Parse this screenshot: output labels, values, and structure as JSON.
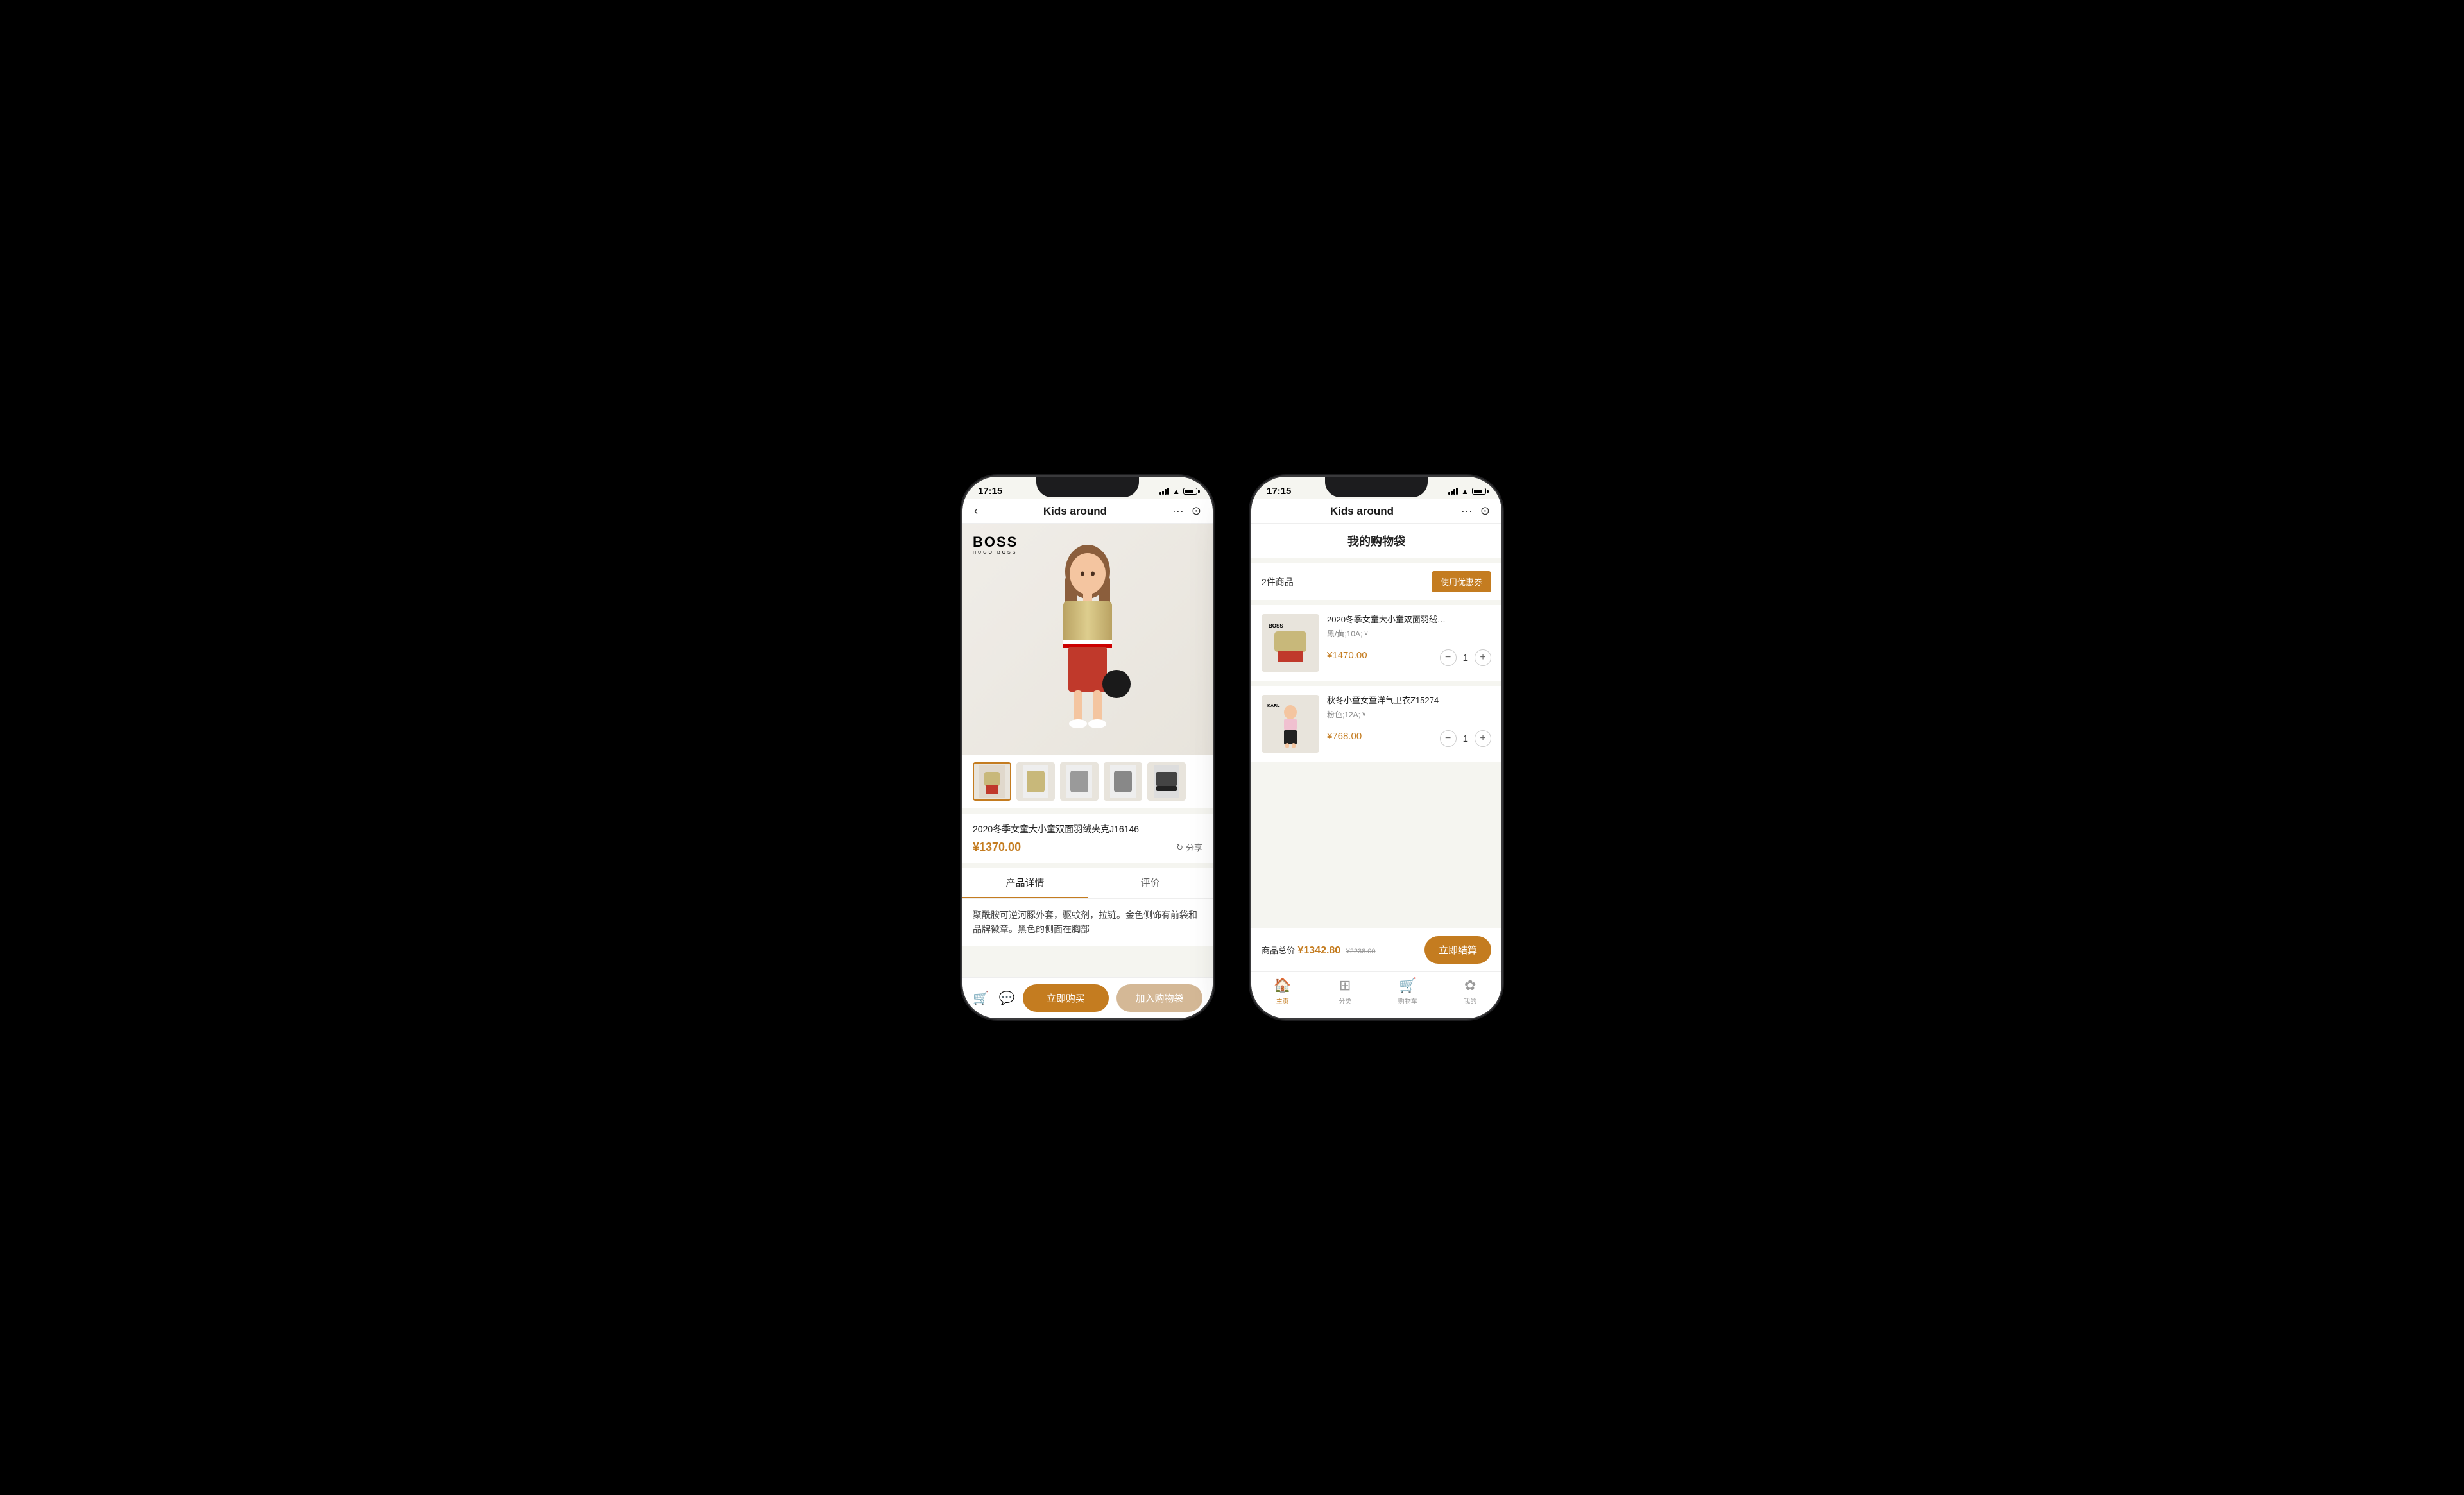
{
  "app": {
    "title": "Kids around",
    "status_time": "17:15"
  },
  "phone1": {
    "nav": {
      "back_label": "‹",
      "title": "Kids around",
      "more_label": "···",
      "scan_label": "⊙"
    },
    "product": {
      "brand": "BOSS",
      "brand_sub": "HUGO BOSS",
      "name": "2020冬季女童大小童双面羽绒夹克J16146",
      "price": "¥1370.00",
      "share_label": "分享",
      "tabs": [
        {
          "label": "产品详情",
          "active": true
        },
        {
          "label": "评价",
          "active": false
        }
      ],
      "description": "聚酰胺可逆河豚外套，驱蚊剂，拉链。金色侧饰有前袋和品牌徽章。黑色的侧面在胸部",
      "btn_buy": "立即购买",
      "btn_cart": "加入购物袋"
    }
  },
  "phone2": {
    "nav": {
      "title": "Kids around",
      "more_label": "···",
      "scan_label": "⊙"
    },
    "cart": {
      "page_title": "我的购物袋",
      "count_label": "2件商品",
      "coupon_label": "使用优惠券",
      "items": [
        {
          "id": 1,
          "name": "2020冬季女童大小童双面羽绒…",
          "variant": "黑/黄;10A;",
          "price": "¥1470.00",
          "qty": 1
        },
        {
          "id": 2,
          "name": "秋冬小童女童洋气卫衣Z15274",
          "variant": "粉色;12A;",
          "price": "¥768.00",
          "qty": 1
        }
      ],
      "total_label": "商品总价",
      "total_price": "¥1342.80",
      "original_price": "¥2238.00",
      "checkout_label": "立即结算"
    },
    "bottom_nav": [
      {
        "label": "主页",
        "icon": "🏠",
        "active": true
      },
      {
        "label": "分类",
        "icon": "⊞",
        "active": false
      },
      {
        "label": "购物车",
        "icon": "🛒",
        "active": false
      },
      {
        "label": "我的",
        "icon": "✿",
        "active": false
      }
    ]
  }
}
